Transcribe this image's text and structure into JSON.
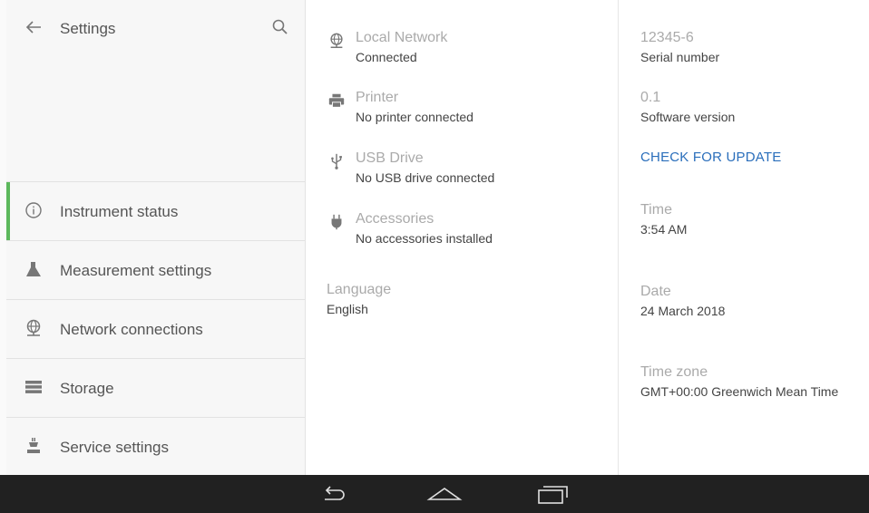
{
  "sidebar": {
    "title": "Settings",
    "back_icon": "arrow-left-icon",
    "search_icon": "magnifier-icon",
    "accent_color": "#5cb85c",
    "items": [
      {
        "label": "Instrument status",
        "icon": "info-circle-icon",
        "active": true
      },
      {
        "label": "Measurement settings",
        "icon": "flask-icon",
        "active": false
      },
      {
        "label": "Network connections",
        "icon": "globe-network-icon",
        "active": false
      },
      {
        "label": "Storage",
        "icon": "storage-icon",
        "active": false
      },
      {
        "label": "Service settings",
        "icon": "service-icon",
        "active": false
      }
    ]
  },
  "devices": {
    "local_network": {
      "title": "Local Network",
      "status": "Connected",
      "icon": "globe-network-icon"
    },
    "printer": {
      "title": "Printer",
      "status": "No printer connected",
      "icon": "printer-icon"
    },
    "usb": {
      "title": "USB Drive",
      "status": "No USB drive connected",
      "icon": "usb-icon"
    },
    "accessories": {
      "title": "Accessories",
      "status": "No accessories installed",
      "icon": "plug-icon"
    },
    "language": {
      "label": "Language",
      "value": "English"
    }
  },
  "system": {
    "serial": {
      "value": "12345-6",
      "label": "Serial number"
    },
    "software": {
      "value": "0.1",
      "label": "Software version"
    },
    "update_label": "CHECK FOR UPDATE",
    "update_color": "#2a6ebb",
    "time": {
      "label": "Time",
      "value": "3:54 AM"
    },
    "date": {
      "label": "Date",
      "value": "24 March 2018"
    },
    "timezone": {
      "label": "Time zone",
      "value": "GMT+00:00 Greenwich Mean Time"
    }
  },
  "navbar": {
    "back_icon": "nav-back-icon",
    "home_icon": "nav-home-icon",
    "recents_icon": "nav-recents-icon"
  }
}
